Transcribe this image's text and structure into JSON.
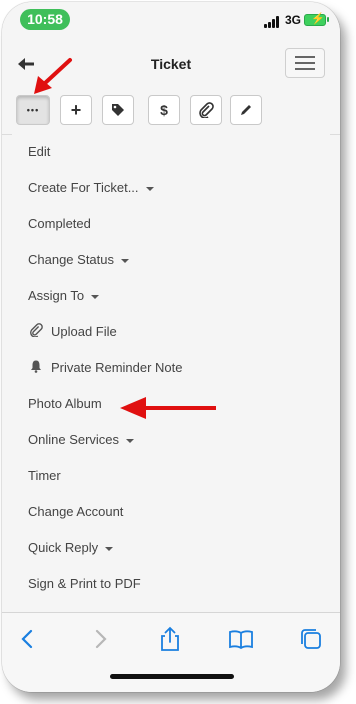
{
  "status": {
    "time": "10:58",
    "network": "3G"
  },
  "header": {
    "title": "Ticket"
  },
  "toolbar": {
    "more_label": "•••",
    "add_label": "+",
    "price_label": "$"
  },
  "menu": {
    "items": [
      {
        "label": "Edit",
        "dropdown": false
      },
      {
        "label": "Create For Ticket...",
        "dropdown": true
      },
      {
        "label": "Completed",
        "dropdown": false
      },
      {
        "label": "Change Status",
        "dropdown": true
      },
      {
        "label": "Assign To",
        "dropdown": true
      },
      {
        "label": "Upload File",
        "dropdown": false,
        "icon": "paperclip-icon"
      },
      {
        "label": "Private Reminder Note",
        "dropdown": false,
        "icon": "bell-icon"
      },
      {
        "label": "Photo Album",
        "dropdown": false
      },
      {
        "label": "Online Services",
        "dropdown": true
      },
      {
        "label": "Timer",
        "dropdown": false
      },
      {
        "label": "Change Account",
        "dropdown": false
      },
      {
        "label": "Quick Reply",
        "dropdown": true
      },
      {
        "label": "Sign & Print to PDF",
        "dropdown": false
      }
    ]
  },
  "colors": {
    "accent": "#1a7fe0",
    "annotation": "#e01010",
    "time_pill": "#3fbf5a"
  }
}
